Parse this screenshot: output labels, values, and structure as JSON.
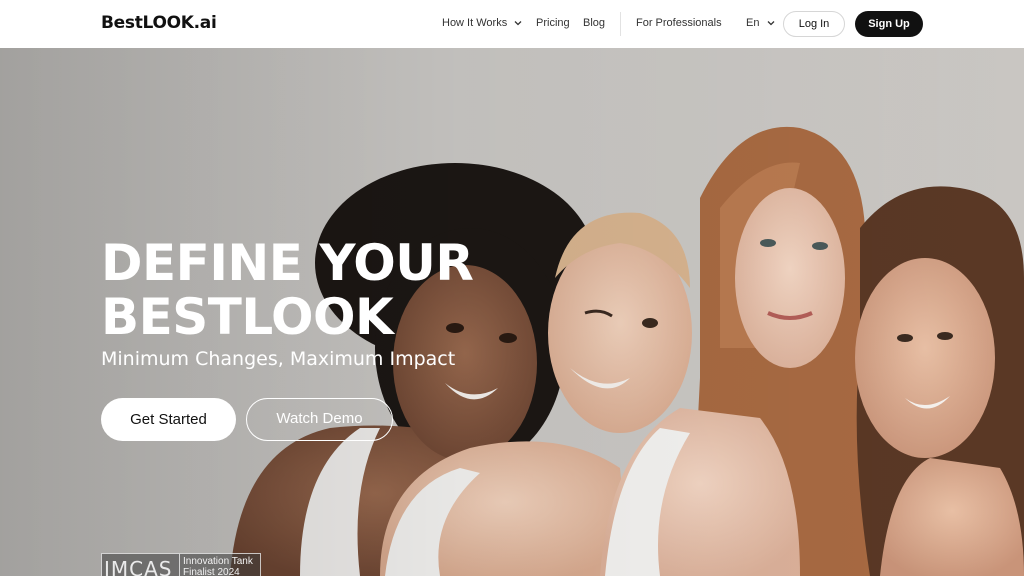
{
  "header": {
    "logo": "BestLOOK.ai",
    "nav": {
      "how_it_works": "How It Works",
      "pricing": "Pricing",
      "blog": "Blog",
      "for_professionals": "For Professionals",
      "language": "En"
    },
    "login": "Log In",
    "signup": "Sign Up"
  },
  "hero": {
    "title_line1": "DEFINE YOUR",
    "title_line2": "BESTLOOK",
    "subtitle": "Minimum Changes, Maximum Impact",
    "get_started": "Get Started",
    "watch_demo": "Watch Demo",
    "badge": {
      "logo": "IMCAS",
      "line1": "Innovation Tank",
      "line2": "Finalist 2024"
    }
  }
}
